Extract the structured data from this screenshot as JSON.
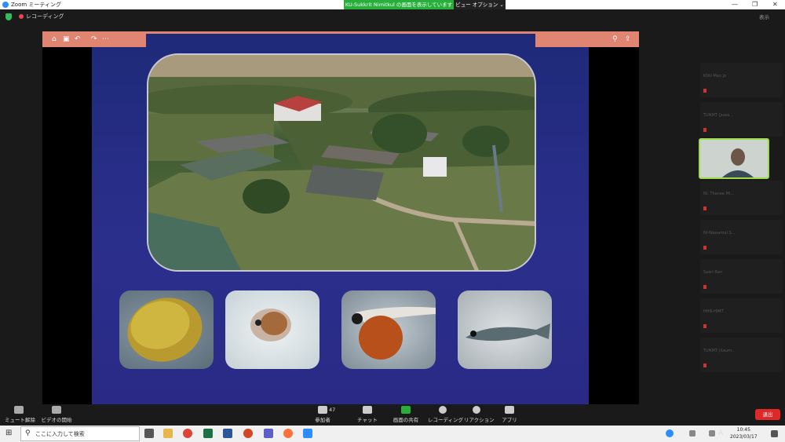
{
  "window": {
    "title": "Zoom ミーティング",
    "minimize": "—",
    "restore": "❐",
    "close": "✕"
  },
  "share_banner": {
    "text": "KU-Sukkrit Nimitkul の画面を表示しています",
    "view_options": "ビュー オプション ⌄"
  },
  "recording": {
    "label": "レコーディング"
  },
  "top_right_label": "表示",
  "toolbar": {
    "mute_label": "ミュート解除",
    "video_label": "ビデオの開始",
    "participants_label": "参加者",
    "participants_count": "47",
    "chat_label": "チャット",
    "share_label": "画面の共有",
    "record_label": "レコーディング",
    "reactions_label": "リアクション",
    "apps_label": "アプリ",
    "leave_label": "退出"
  },
  "ppt_toolbar": {
    "home": "⌂",
    "save": "▣",
    "undo": "↶",
    "redo": "↷",
    "more": "⋯",
    "search": "⚲",
    "share": "⇪"
  },
  "participants": [
    {
      "name": "KNU-Mao Jo"
    },
    {
      "name": "TUNMT (Juwa..."
    },
    {
      "name": "NI. Thanee Mi..."
    },
    {
      "name": "NI-Waewmai S..."
    },
    {
      "name": "Saari Ran"
    },
    {
      "name": "HHN-HIMT"
    },
    {
      "name": "TUNMT (Xaum..."
    }
  ],
  "taskbar": {
    "search_placeholder": "ここに入力して検索",
    "ime_label": "A",
    "time": "10:45",
    "date": "2023/03/17"
  },
  "colors": {
    "share_green": "#27ae3b",
    "leave_red": "#e02828",
    "ppt_header": "#e08572",
    "slide_bg": "#2b2f8c",
    "active_speaker": "#9ddb4a"
  }
}
